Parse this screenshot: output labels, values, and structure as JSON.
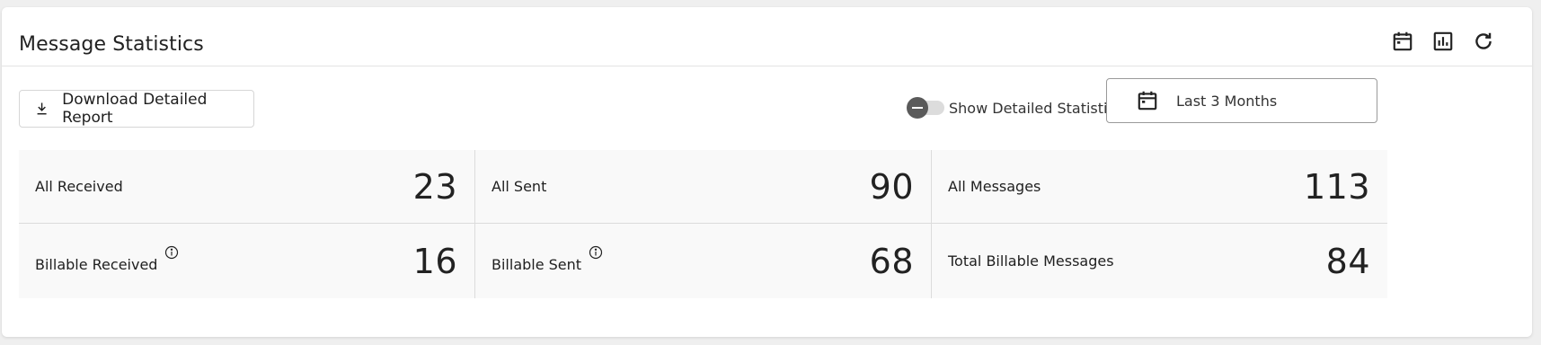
{
  "header": {
    "title": "Message Statistics",
    "icons": [
      "calendar-icon",
      "bar-chart-icon",
      "refresh-icon"
    ]
  },
  "toolbar": {
    "download_label": "Download Detailed Report",
    "toggle_label": "Show Detailed Statistics",
    "toggle_on": false,
    "date_range": "Last 3 Months"
  },
  "stats": {
    "all_received": {
      "label": "All Received",
      "value": "23"
    },
    "all_sent": {
      "label": "All Sent",
      "value": "90"
    },
    "all_messages": {
      "label": "All Messages",
      "value": "113"
    },
    "billable_received": {
      "label": "Billable Received",
      "value": "16"
    },
    "billable_sent": {
      "label": "Billable Sent",
      "value": "68"
    },
    "total_billable": {
      "label": "Total Billable Messages",
      "value": "84"
    }
  }
}
